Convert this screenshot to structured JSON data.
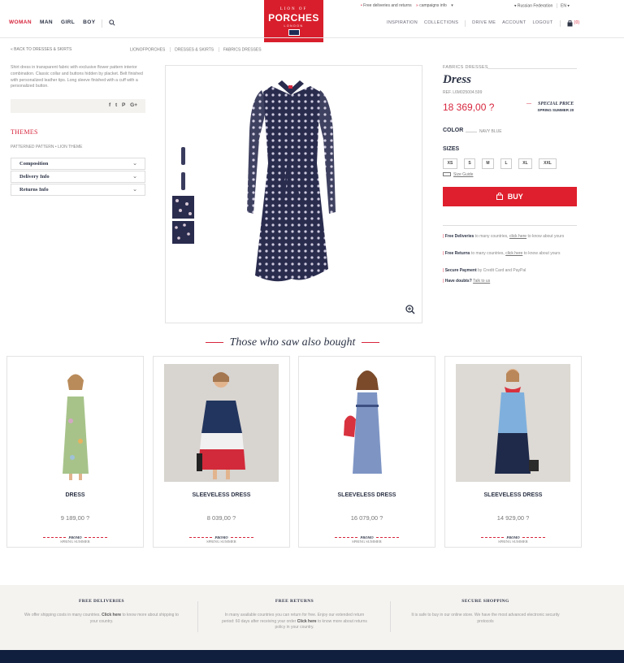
{
  "header": {
    "nav_left": [
      {
        "label": "WOMAN",
        "active": true
      },
      {
        "label": "MAN"
      },
      {
        "label": "GIRL"
      },
      {
        "label": "BOY"
      }
    ],
    "logo": {
      "line1": "LION OF",
      "line2": "PORCHES",
      "line3": "LONDON"
    },
    "topbar": {
      "free_deliveries": "Free deliveries and returns",
      "campaigns": "campaigns info",
      "country": "Russian Federation",
      "lang": "EN"
    },
    "nav_right": [
      "INSPIRATION",
      "COLLECTIONS",
      "DRIVE ME",
      "ACCOUNT",
      "LOGOUT"
    ],
    "cart_count": "(0)"
  },
  "breadcrumbs": {
    "back": "« BACK TO DRESSES & SKIRTS",
    "items": [
      "LIONOFPORCHES",
      "DRESSES & SKIRTS",
      "FABRICS DRESSES"
    ]
  },
  "left": {
    "description": "Shirt dress in transparent fabric with exclusive flower pattern interior combination. Classic collar and buttons hidden by placket. Belt finished with personalized leather tips. Long sleeve finished with a cuff with a personalized button.",
    "share_icons": [
      "f",
      "t",
      "P",
      "G+"
    ],
    "themes_title": "THEMES",
    "themes_links": "PATTERNED PATTERN • LION THEME",
    "accordion": [
      "Composition",
      "Delivery Info",
      "Returns Info"
    ]
  },
  "product": {
    "category": "FABRICS DRESSES",
    "title": "Dress",
    "ref": "REF. L6M025004.599",
    "price": "18 369,00 ?",
    "special_price": "SPECIAL PRICE",
    "season": "SPRING SUMMER 20",
    "color_label": "COLOR",
    "color_value": "NAVY BLUE",
    "sizes_label": "SIZES",
    "sizes": [
      "XS",
      "S",
      "M",
      "L",
      "XL",
      "XXL"
    ],
    "size_guide": "Size Guide",
    "buy_label": "BUY",
    "info": [
      {
        "bold": "Free Deliveries",
        "text": " to many countries, ",
        "link": "click here",
        "tail": " to know about yours"
      },
      {
        "bold": "Free Returns",
        "text": " to many countries, ",
        "link": "click here",
        "tail": " to know about yours"
      },
      {
        "bold": "Secure Payment",
        "text": " by Credit Card and PayPal",
        "link": "",
        "tail": ""
      },
      {
        "bold": "Have doubts?",
        "text": " ",
        "link": "Talk to us",
        "tail": ""
      }
    ]
  },
  "related": {
    "title": "Those who saw also bought",
    "items": [
      {
        "name": "DRESS",
        "price": "9 189,00 ?",
        "promo": "PROMO",
        "season": "SPRING SUMMER"
      },
      {
        "name": "SLEEVELESS DRESS",
        "price": "8 039,00 ?",
        "promo": "PROMO",
        "season": "SPRING SUMMER"
      },
      {
        "name": "SLEEVELESS DRESS",
        "price": "16 079,00 ?",
        "promo": "PROMO",
        "season": "SPRING SUMMER"
      },
      {
        "name": "SLEEVELESS DRESS",
        "price": "14 929,00 ?",
        "promo": "PROMO",
        "season": "SPRING SUMMER"
      }
    ]
  },
  "footer": {
    "cols": [
      {
        "title": "FREE DELIVERIES",
        "text": "We offer shipping costs in many countries.",
        "link": "Click here",
        "tail": "to know more about shipping to your country."
      },
      {
        "title": "FREE RETURNS",
        "text": "In many available countries you can return for free. Enjoy our extended return period: 60 days after receiving your order",
        "link": "Click here",
        "tail": "to know more about returns policy in your country."
      },
      {
        "title": "SECURE SHOPPING",
        "text": "It is safe to buy in our online store. We have the most advanced electronic security protocols",
        "link": "",
        "tail": ""
      }
    ]
  },
  "colors": {
    "accent": "#d7263d",
    "navy": "#2d3446",
    "buy": "#df1f2d",
    "footer_bg": "#f5f3f0",
    "bottom_bar": "#0f1f3d"
  }
}
